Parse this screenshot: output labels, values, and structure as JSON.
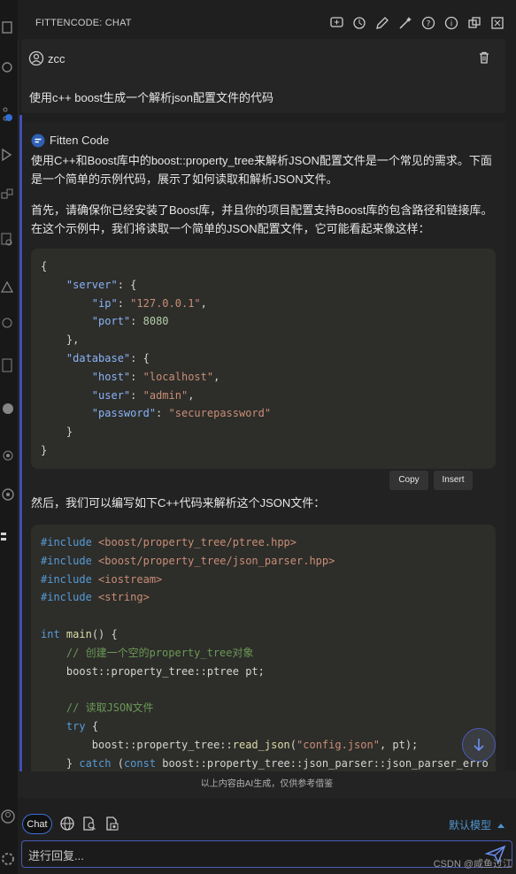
{
  "header": {
    "title": "FITTENCODE: CHAT",
    "actions": [
      "new-chat-icon",
      "history-icon",
      "edit-icon",
      "magic-wand-icon",
      "help-icon",
      "info-icon",
      "copy-window-icon",
      "close-panel-icon"
    ]
  },
  "user_message": {
    "name": "zcc",
    "text": "使用c++ boost生成一个解析json配置文件的代码"
  },
  "bot_message": {
    "name": "Fitten Code",
    "para1": "使用C++和Boost库中的boost::property_tree来解析JSON配置文件是一个常见的需求。下面是一个简单的示例代码，展示了如何读取和解析JSON文件。",
    "para2": "首先，请确保你已经安装了Boost库，并且你的项目配置支持Boost库的包含路径和链接库。在这个示例中，我们将读取一个简单的JSON配置文件，它可能看起来像这样：",
    "json_code": [
      "{",
      "    \"server\": {",
      "        \"ip\": \"127.0.0.1\",",
      "        \"port\": 8080",
      "    },",
      "    \"database\": {",
      "        \"host\": \"localhost\",",
      "        \"user\": \"admin\",",
      "        \"password\": \"securepassword\"",
      "    }",
      "}"
    ],
    "copy_label": "Copy",
    "insert_label": "Insert",
    "para3": "然后，我们可以编写如下C++代码来解析这个JSON文件：",
    "cpp_code": [
      "#include <boost/property_tree/ptree.hpp>",
      "#include <boost/property_tree/json_parser.hpp>",
      "#include <iostream>",
      "#include <string>",
      "",
      "int main() {",
      "    // 创建一个空的property_tree对象",
      "    boost::property_tree::ptree pt;",
      "",
      "    // 读取JSON文件",
      "    try {",
      "        boost::property_tree::read_json(\"config.json\", pt);",
      "    } catch (const boost::property_tree::json_parser::json_parser_erro"
    ]
  },
  "disclaimer": "以上内容由AI生成，仅供参考借鉴",
  "footer": {
    "chat_label": "Chat",
    "model_label": "默认模型",
    "input_placeholder": "进行回复...",
    "watermark": "CSDN @咸鱼过江"
  },
  "colors": {
    "accent": "#4b5bb8",
    "link": "#4e94ce",
    "code_bg": "#2d2d2a"
  }
}
